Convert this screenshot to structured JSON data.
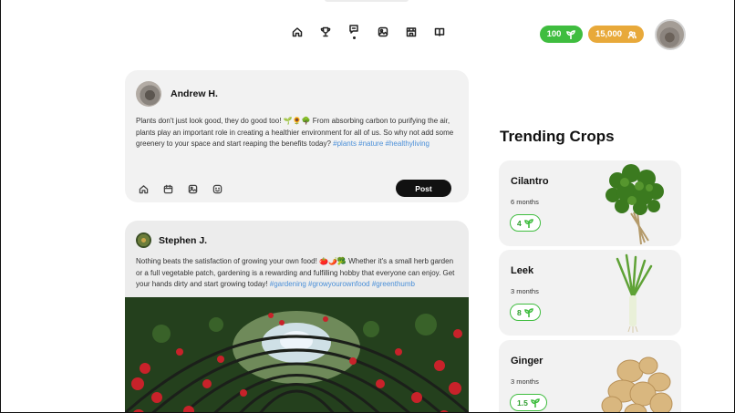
{
  "nav": {
    "items": [
      {
        "name": "home",
        "icon": "home-icon"
      },
      {
        "name": "trophy",
        "icon": "trophy-icon"
      },
      {
        "name": "chat",
        "icon": "chat-icon",
        "active": true
      },
      {
        "name": "gallery",
        "icon": "image-icon"
      },
      {
        "name": "store",
        "icon": "store-icon"
      },
      {
        "name": "guide",
        "icon": "book-icon"
      }
    ]
  },
  "header": {
    "points_value": "100",
    "points_icon": "sprout-icon",
    "followers_value": "15,000",
    "followers_icon": "users-icon",
    "colors": {
      "green": "#3fbd3f",
      "orange": "#e8a93a"
    }
  },
  "composer": {
    "author": "Andrew H.",
    "text_before": "Plants don't just look good, they do good too! 🌱🌻🌳 From absorbing carbon to purifying the air, plants play an important role in creating a healthier environment for all of us. So why not add some greenery to your space and start reaping the benefits today? ",
    "hashtags": "#plants #nature #healthyliving",
    "tools": [
      "home-icon",
      "calendar-icon",
      "image-icon",
      "emoji-icon"
    ],
    "post_label": "Post"
  },
  "post": {
    "author": "Stephen J.",
    "text_before": "Nothing beats the satisfaction of growing your own food! 🍅🌶️🥦 Whether it's a small herb garden or a full vegetable patch, gardening is a rewarding and fulfilling hobby that everyone can enjoy. Get your hands dirty and start growing today! ",
    "hashtags": "#gardening #growyourownfood #greenthumb"
  },
  "trending": {
    "title": "Trending Crops",
    "crops": [
      {
        "name": "Cilantro",
        "duration": "6 months",
        "count": "4"
      },
      {
        "name": "Leek",
        "duration": "3 months",
        "count": "8"
      },
      {
        "name": "Ginger",
        "duration": "3 months",
        "count": "1.5"
      }
    ]
  }
}
